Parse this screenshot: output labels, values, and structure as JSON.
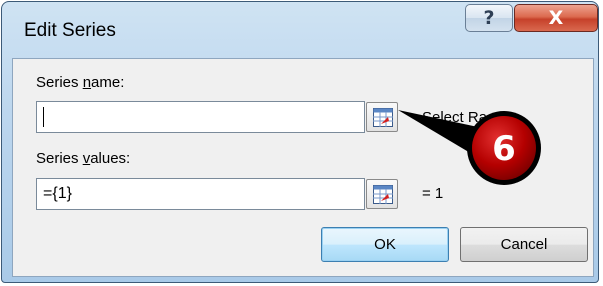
{
  "window": {
    "title": "Edit Series",
    "help_label": "?",
    "close_label": "X"
  },
  "series_name": {
    "label_before": "Series ",
    "label_underline": "n",
    "label_after": "ame:",
    "value": "",
    "preview_text": "Select Ra"
  },
  "series_values": {
    "label_before": "Series ",
    "label_underline": "v",
    "label_after": "alues:",
    "value": "={1}",
    "preview_text": "= 1"
  },
  "buttons": {
    "ok_label": "OK",
    "cancel_label": "Cancel"
  },
  "callout": {
    "number": "6",
    "color": "#c00000"
  },
  "icons": {
    "range_selector": "collapse-dialog-icon"
  }
}
